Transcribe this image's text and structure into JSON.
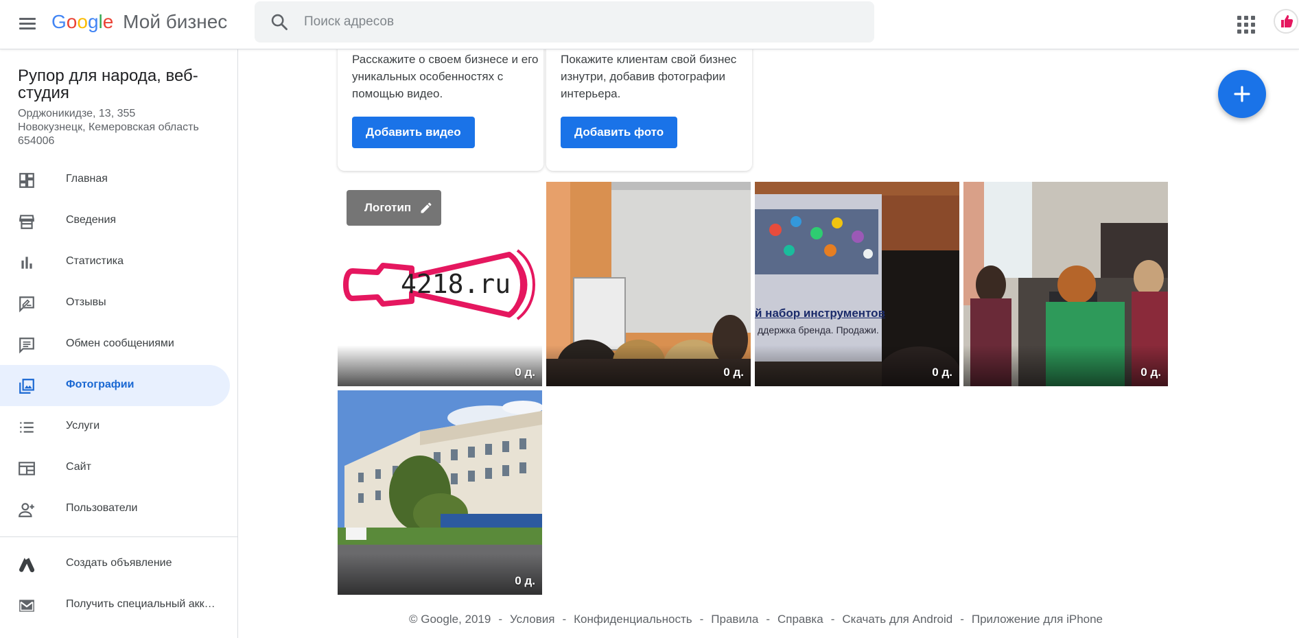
{
  "header": {
    "logo_letters": [
      "G",
      "o",
      "o",
      "g",
      "l",
      "e"
    ],
    "logo_colors": [
      "#4285F4",
      "#EA4335",
      "#FBBC05",
      "#4285F4",
      "#34A853",
      "#EA4335"
    ],
    "product_name": "Мой бизнес",
    "search_placeholder": "Поиск адресов",
    "apps_icon": "apps-grid-icon",
    "avatar_icon": "thumbs-up-icon"
  },
  "business": {
    "name": "Рупор для народа, веб-студия",
    "address_line1": "Орджоникидзе, 13, 355",
    "address_line2": "Новокузнецк, Кемеровская область",
    "address_line3": "654006"
  },
  "nav": [
    {
      "label": "Главная",
      "icon": "dashboard-icon",
      "active": false
    },
    {
      "label": "Сведения",
      "icon": "store-icon",
      "active": false
    },
    {
      "label": "Статистика",
      "icon": "bar-chart-icon",
      "active": false
    },
    {
      "label": "Отзывы",
      "icon": "rate-review-icon",
      "active": false
    },
    {
      "label": "Обмен сообщениями",
      "icon": "message-icon",
      "active": false
    },
    {
      "label": "Фотографии",
      "icon": "photo-library-icon",
      "active": true
    },
    {
      "label": "Услуги",
      "icon": "list-icon",
      "active": false
    },
    {
      "label": "Сайт",
      "icon": "web-icon",
      "active": false
    },
    {
      "label": "Пользователи",
      "icon": "person-add-icon",
      "active": false
    }
  ],
  "nav_secondary": [
    {
      "label": "Создать объявление",
      "icon": "google-ads-icon"
    },
    {
      "label": "Получить специальный акк…",
      "icon": "mail-icon"
    }
  ],
  "cards": {
    "video": {
      "text": "Расскажите о своем бизнесе и его уникальных особенностях с помощью видео.",
      "button": "Добавить видео"
    },
    "photo": {
      "text": "Покажите клиентам свой бизнес изнутри, добавив фотографии интерьера.",
      "button": "Добавить фото"
    }
  },
  "tiles": {
    "logo_badge": "Логотип",
    "logo_text": "4218.ru",
    "days": "0 д.",
    "slide_title": "й набор инструментов",
    "slide_subtitle": "ддержка бренда. Продажи."
  },
  "fab": {
    "icon": "plus-icon"
  },
  "footer": {
    "copyright": "© Google, 2019",
    "links": [
      "Условия",
      "Конфиденциальность",
      "Правила",
      "Справка",
      "Скачать для Android",
      "Приложение для iPhone"
    ]
  },
  "colors": {
    "accent": "#1a73e8",
    "active_bg": "#e8f0fe",
    "active_text": "#1967d2",
    "logo_pink": "#e5175f"
  }
}
